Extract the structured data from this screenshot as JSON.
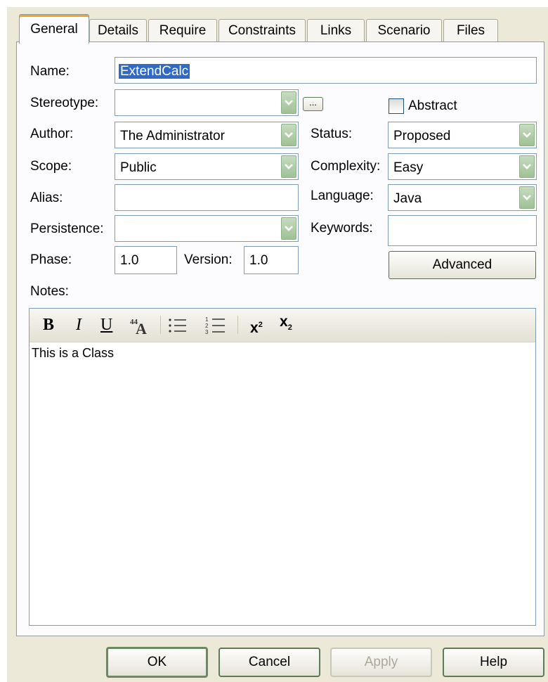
{
  "tabs": [
    "General",
    "Details",
    "Require",
    "Constraints",
    "Links",
    "Scenario",
    "Files"
  ],
  "form": {
    "name_label": "Name:",
    "name_value": "ExtendCalc",
    "stereotype_label": "Stereotype:",
    "stereotype_value": "",
    "ellipsis_label": "...",
    "abstract_label": "Abstract",
    "author_label": "Author:",
    "author_value": "The Administrator",
    "status_label": "Status:",
    "status_value": "Proposed",
    "scope_label": "Scope:",
    "scope_value": "Public",
    "complexity_label": "Complexity:",
    "complexity_value": "Easy",
    "alias_label": "Alias:",
    "alias_value": "",
    "language_label": "Language:",
    "language_value": "Java",
    "persistence_label": "Persistence:",
    "persistence_value": "",
    "keywords_label": "Keywords:",
    "keywords_value": "",
    "phase_label": "Phase:",
    "phase_value": "1.0",
    "version_label": "Version:",
    "version_value": "1.0",
    "advanced_label": "Advanced",
    "notes_label": "Notes:",
    "notes_text": "This is a Class"
  },
  "toolbar": {
    "bold": "B",
    "italic": "I",
    "underline": "U",
    "superscript": "x",
    "superscript_mark": "2",
    "subscript": "x",
    "subscript_mark": "2",
    "icons": [
      "font-color-icon",
      "bullet-list-icon",
      "numbered-list-icon"
    ]
  },
  "buttons": {
    "ok": "OK",
    "cancel": "Cancel",
    "apply": "Apply",
    "help": "Help"
  }
}
